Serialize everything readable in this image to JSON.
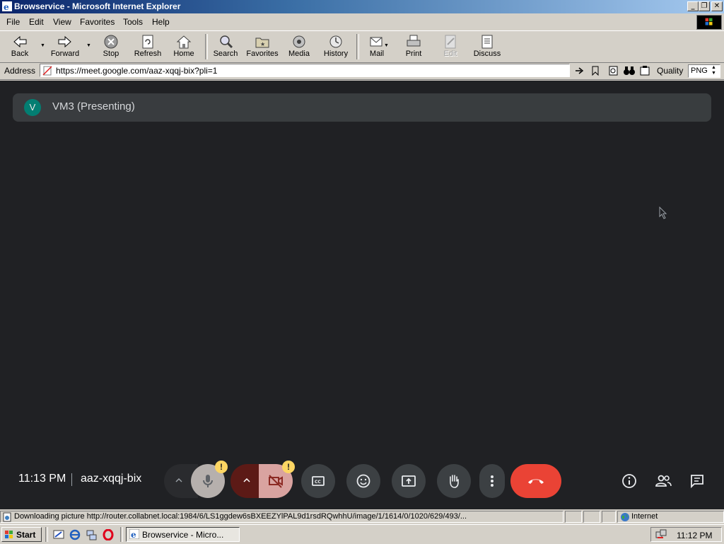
{
  "window": {
    "title": "Browservice - Microsoft Internet Explorer",
    "controls": [
      "minimize",
      "maximize",
      "close"
    ]
  },
  "menu": [
    {
      "label": "File",
      "icon": null
    },
    {
      "label": "Edit"
    },
    {
      "label": "View"
    },
    {
      "label": "Favorites"
    },
    {
      "label": "Tools"
    },
    {
      "label": "Help"
    }
  ],
  "toolbar": {
    "back": "Back",
    "forward": "Forward",
    "stop": "Stop",
    "refresh": "Refresh",
    "home": "Home",
    "search": "Search",
    "favorites": "Favorites",
    "media": "Media",
    "history": "History",
    "mail": "Mail",
    "print": "Print",
    "edit": "Edit",
    "discuss": "Discuss"
  },
  "address": {
    "label": "Address",
    "url": "https://meet.google.com/aaz-xqqj-bix?pli=1",
    "quality_label": "Quality",
    "quality_value": "PNG"
  },
  "meet": {
    "presenter_initial": "V",
    "presenter_name": "VM3 (Presenting)",
    "avatar_color": "#00897b",
    "time": "11:13 PM",
    "meeting_code": "aaz-xqqj-bix",
    "warn_badge": "!",
    "end_call_color": "#ea4335",
    "background": "#202124"
  },
  "statusbar": {
    "text": "Downloading picture http://router.collabnet.local:1984/6/LS1ggdew6sBXEEZYlPAL9d1rsdRQwhhU/image/1/1614/0/1020/629/493/...",
    "zone": "Internet"
  },
  "taskbar": {
    "start": "Start",
    "task_label": "Browservice - Micro...",
    "clock": "11:12 PM"
  }
}
